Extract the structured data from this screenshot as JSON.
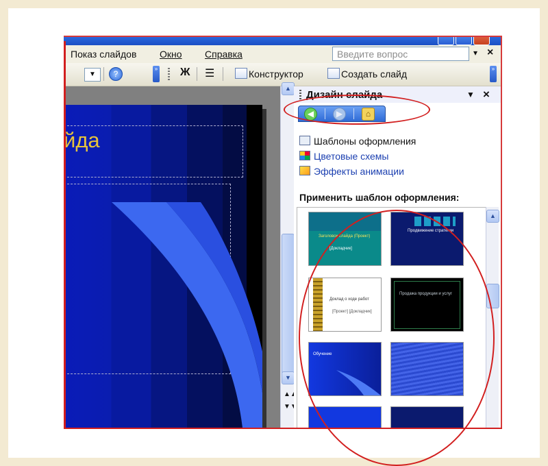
{
  "menu": {
    "items": [
      {
        "label": "Показ слайдов",
        "underline_index": -1
      },
      {
        "label": "Окно",
        "underline_index": 0
      },
      {
        "label": "Справка",
        "underline_index": 0
      }
    ],
    "ask_placeholder": "Введите вопрос",
    "ask_dropdown_glyph": "▾",
    "close_glyph": "×"
  },
  "toolbar": {
    "bold_label": "Ж",
    "designer_label": "Конструктор",
    "new_slide_label": "Создать слайд"
  },
  "slide": {
    "title_fragment": "йда",
    "title_color": "#e6c33c"
  },
  "task_pane": {
    "title": "Дизайн слайда",
    "menu_glyph": "▼",
    "close_glyph": "×",
    "links": [
      {
        "label": "Шаблоны оформления",
        "icon": "templates-icon",
        "active": true
      },
      {
        "label": "Цветовые схемы",
        "icon": "color-schemes-icon",
        "active": false
      },
      {
        "label": "Эффекты анимации",
        "icon": "animation-effects-icon",
        "active": false
      }
    ],
    "apply_label": "Применить шаблон оформления:",
    "thumbnails": [
      {
        "title": "Заголовок слайда (Проект)",
        "subtitle": "[Докладчик]",
        "style": "teal"
      },
      {
        "title": "Продвижение стратегии",
        "subtitle": "",
        "style": "navy-squares"
      },
      {
        "title": "Доклад о ходе работ",
        "subtitle": "[Проект] [Докладчик]",
        "style": "white-gold"
      },
      {
        "title": "Продажа продукции и услуг",
        "subtitle": "",
        "style": "black"
      },
      {
        "title": "Обучение",
        "subtitle": "",
        "style": "blue-curve"
      },
      {
        "title": "",
        "subtitle": "",
        "style": "blue-texture"
      }
    ]
  },
  "colors": {
    "annotation": "#d21f1f",
    "xp_blue": "#2f6bd6"
  }
}
